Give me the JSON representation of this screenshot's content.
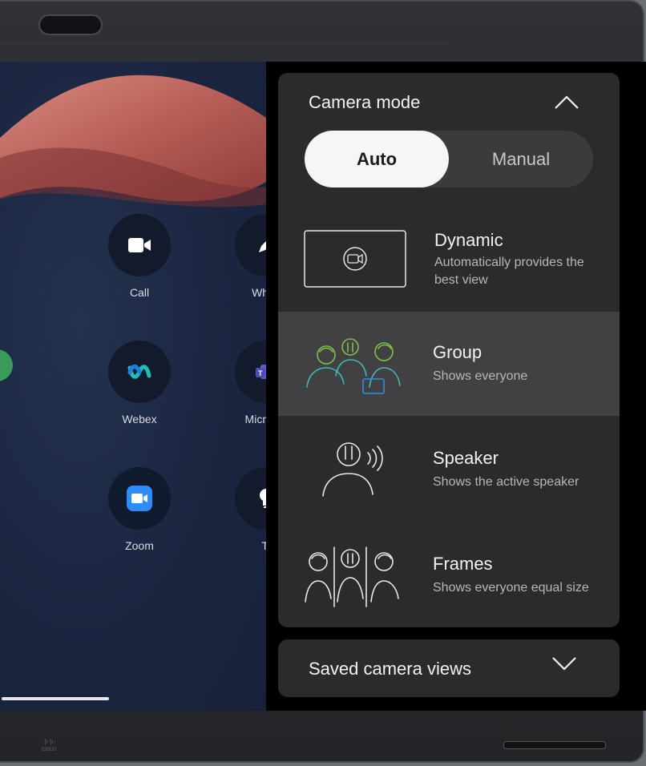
{
  "home": {
    "apps": [
      {
        "id": "call",
        "label": "Call",
        "icon": "video-camera-icon"
      },
      {
        "id": "whiteboard",
        "label": "White",
        "icon": "pen-icon"
      },
      {
        "id": "webex",
        "label": "Webex",
        "icon": "webex-icon"
      },
      {
        "id": "teams",
        "label": "Microsof",
        "icon": "teams-icon"
      },
      {
        "id": "zoom",
        "label": "Zoom",
        "icon": "zoom-icon"
      },
      {
        "id": "tips",
        "label": "Ti",
        "icon": "lightbulb-icon"
      }
    ]
  },
  "camera_panel": {
    "title": "Camera mode",
    "segmented": {
      "auto": "Auto",
      "manual": "Manual",
      "selected": "Auto"
    },
    "modes": [
      {
        "title": "Dynamic",
        "desc": "Automatically provides the best view",
        "icon": "dynamic-view-icon",
        "selected": false
      },
      {
        "title": "Group",
        "desc": "Shows everyone",
        "icon": "group-icon",
        "selected": true
      },
      {
        "title": "Speaker",
        "desc": "Shows the active speaker",
        "icon": "speaker-icon",
        "selected": false
      },
      {
        "title": "Frames",
        "desc": "Shows everyone equal size",
        "icon": "frames-icon",
        "selected": false
      }
    ]
  },
  "saved_views": {
    "label": "Saved camera views"
  },
  "device": {
    "brand": "cisco"
  },
  "colors": {
    "panel_bg": "#2b2b2c",
    "selected_bg": "#414143",
    "accent_green": "#7dc04a",
    "accent_teal": "#3fb8b0",
    "accent_blue": "#2f8fd8",
    "zoom_blue": "#2d8cff"
  }
}
